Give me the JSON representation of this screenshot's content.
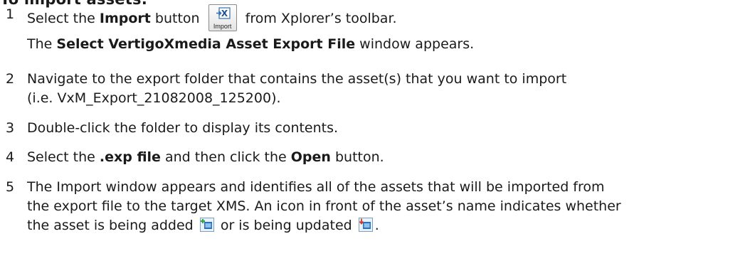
{
  "heading": "To import assets:",
  "steps": [
    {
      "number": "1",
      "p1": "Select the ",
      "b1": "Import",
      "p2": " button ",
      "button_caption": "Import",
      "p3": " from Xplorer’s toolbar.",
      "sub_b": "The ",
      "sub_b1": "Select VertigoXmedia Asset Export File",
      "sub_p2": " window appears."
    },
    {
      "number": "2",
      "line1": "Navigate to the export folder that contains the asset(s) that you want to import",
      "line2": "(i.e. VxM_Export_21082008_125200)."
    },
    {
      "number": "3",
      "line1": "Double-click the folder to display its contents."
    },
    {
      "number": "4",
      "p1": "Select the ",
      "b1": ".exp file",
      "p2": " and then click the ",
      "b2": "Open",
      "p3": " button."
    },
    {
      "number": "5",
      "line1": "The Import window appears and identifies all of the assets that will be imported from",
      "line2": "the export file to the target XMS. An icon in front of the asset’s name indicates whether",
      "line3a": "the asset is being added ",
      "line3b": " or is being updated ",
      "line3c": "."
    }
  ],
  "icons": {
    "import_button": "import-arrow-x-icon",
    "added": "asset-added-icon",
    "updated": "asset-updated-icon"
  },
  "colors": {
    "text": "#1a1a1a",
    "icon_blue": "#2f6fb8",
    "icon_green": "#3aa24a",
    "icon_red": "#d23a2a"
  }
}
